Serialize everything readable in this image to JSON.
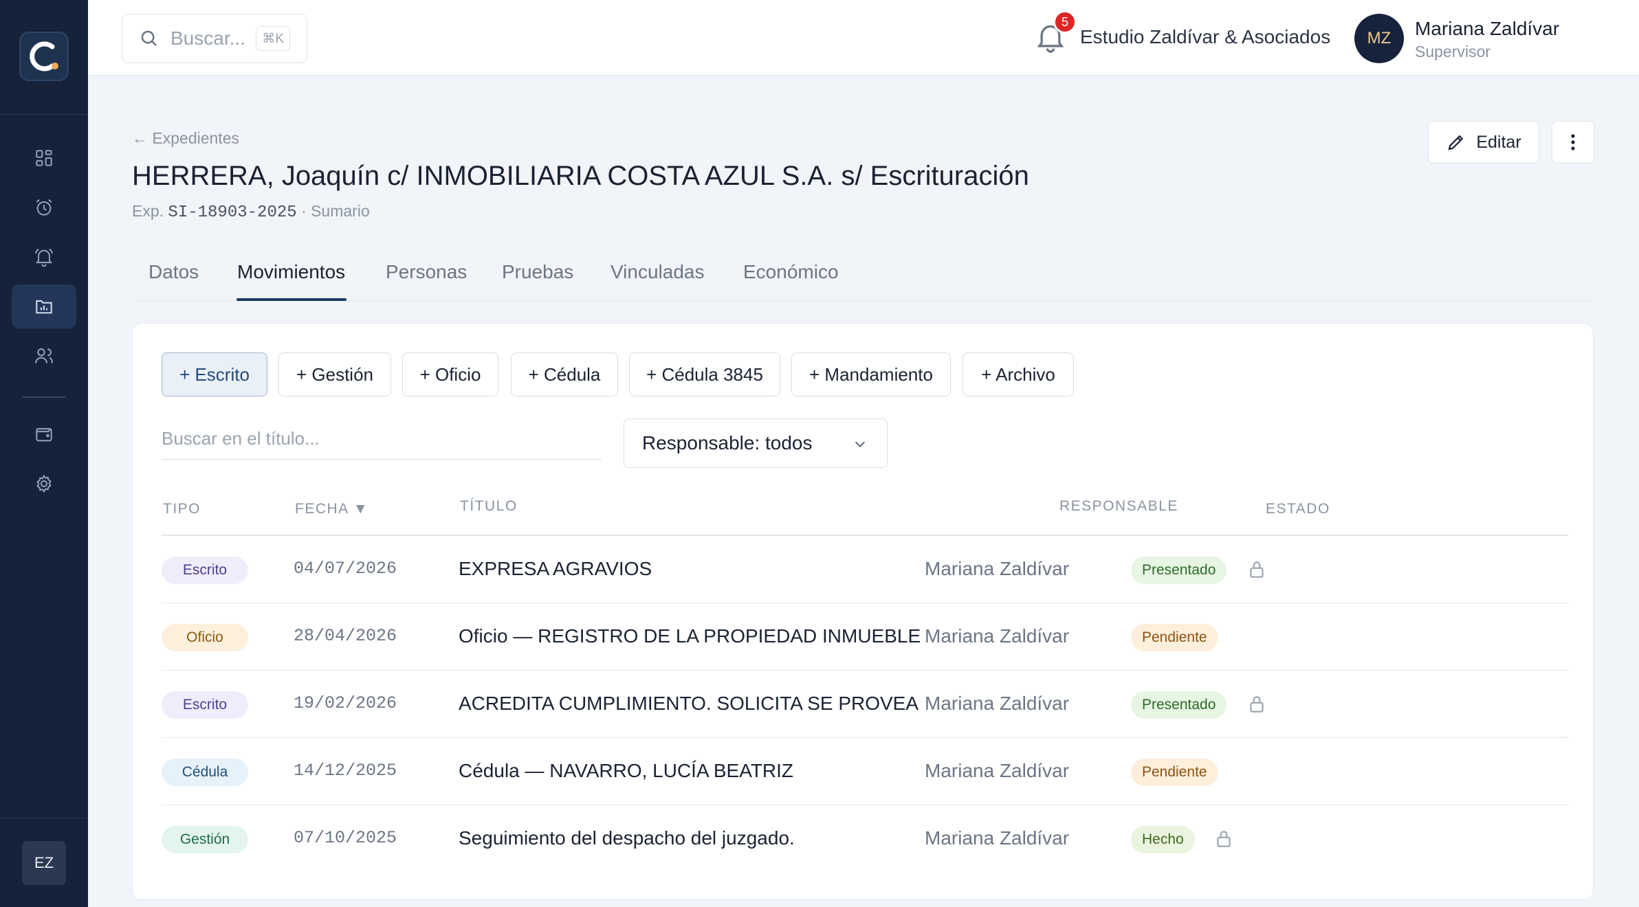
{
  "sidebar": {
    "logo_letter": "C",
    "user_initials": "EZ",
    "items": [
      {
        "icon": "dashboard-icon",
        "active": false
      },
      {
        "icon": "alarm-clock-icon",
        "active": false
      },
      {
        "icon": "bell-icon",
        "active": false
      },
      {
        "icon": "folder-chart-icon",
        "active": true
      },
      {
        "icon": "users-icon",
        "active": false
      },
      {
        "icon": "wallet-icon",
        "active": false
      },
      {
        "icon": "gear-icon",
        "active": false
      }
    ]
  },
  "topbar": {
    "search_placeholder": "Buscar...",
    "search_shortcut": "⌘K",
    "notification_count": "5",
    "organization": "Estudio Zaldívar & Asociados",
    "user": {
      "initials": "MZ",
      "name": "Mariana Zaldívar",
      "role": "Supervisor"
    }
  },
  "header": {
    "breadcrumb": "← Expedientes",
    "title": "HERRERA, Joaquín c/ INMOBILIARIA COSTA AZUL S.A. s/ Escrituración",
    "exp_prefix": "Exp.",
    "exp_code": "SI-18903-2025",
    "exp_suffix": "· Sumario",
    "edit_label": "Editar"
  },
  "tabs": [
    {
      "label": "Datos",
      "active": false
    },
    {
      "label": "Movimientos",
      "active": true
    },
    {
      "label": "Personas",
      "active": false
    },
    {
      "label": "Pruebas",
      "active": false
    },
    {
      "label": "Vinculadas",
      "active": false
    },
    {
      "label": "Económico",
      "active": false
    }
  ],
  "actions": [
    {
      "label": "+ Escrito",
      "primary": true
    },
    {
      "label": "+ Gestión",
      "primary": false
    },
    {
      "label": "+ Oficio",
      "primary": false
    },
    {
      "label": "+ Cédula",
      "primary": false
    },
    {
      "label": "+ Cédula 3845",
      "primary": false
    },
    {
      "label": "+ Mandamiento",
      "primary": false
    },
    {
      "label": "+ Archivo",
      "primary": false
    }
  ],
  "filters": {
    "title_search_placeholder": "Buscar en el título...",
    "responsable_select": "Responsable: todos"
  },
  "table": {
    "columns": {
      "tipo": "TIPO",
      "fecha": "FECHA ▼",
      "titulo": "TÍTULO",
      "responsable": "RESPONSABLE",
      "estado": "ESTADO"
    },
    "rows": [
      {
        "tipo": "Escrito",
        "fecha": "04/07/2026",
        "titulo": "EXPRESA AGRAVIOS",
        "responsable": "Mariana Zaldívar",
        "estado": "Presentado",
        "locked": true
      },
      {
        "tipo": "Oficio",
        "fecha": "28/04/2026",
        "titulo": "Oficio — REGISTRO DE LA PROPIEDAD INMUEBLE",
        "responsable": "Mariana Zaldívar",
        "estado": "Pendiente",
        "locked": false
      },
      {
        "tipo": "Escrito",
        "fecha": "19/02/2026",
        "titulo": "ACREDITA CUMPLIMIENTO. SOLICITA SE PROVEA",
        "responsable": "Mariana Zaldívar",
        "estado": "Presentado",
        "locked": true
      },
      {
        "tipo": "Cédula",
        "fecha": "14/12/2025",
        "titulo": "Cédula — NAVARRO, LUCÍA BEATRIZ",
        "responsable": "Mariana Zaldívar",
        "estado": "Pendiente",
        "locked": false
      },
      {
        "tipo": "Gestión",
        "fecha": "07/10/2025",
        "titulo": "Seguimiento del despacho del juzgado.",
        "responsable": "Mariana Zaldívar",
        "estado": "Hecho",
        "locked": true
      }
    ]
  },
  "colors": {
    "sidebar_bg": "#16213a",
    "accent": "#1d3a63",
    "badge_red": "#dc2626",
    "tipo_escrito": "#efedfb",
    "tipo_oficio": "#fdf0dc",
    "tipo_cedula": "#e6f1fa",
    "tipo_gestion": "#e4f5ee",
    "estado_presentado": "#e7f5e3",
    "estado_pendiente": "#fdefdc",
    "estado_hecho": "#eaf4de"
  }
}
